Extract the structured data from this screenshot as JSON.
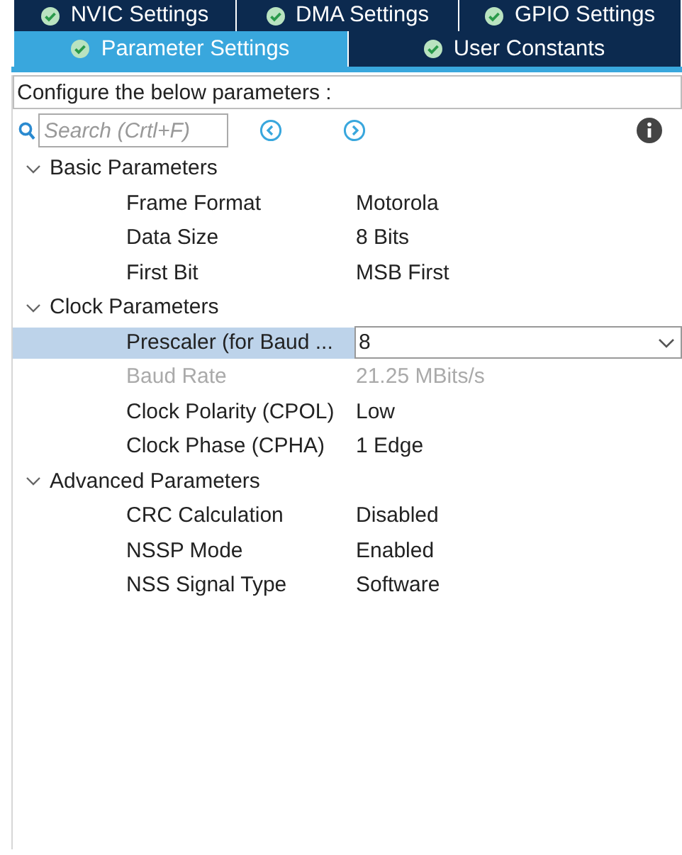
{
  "tabs_top": [
    {
      "label": "NVIC Settings",
      "selected": false
    },
    {
      "label": "DMA Settings",
      "selected": false
    },
    {
      "label": "GPIO Settings",
      "selected": false
    }
  ],
  "tabs_bottom": [
    {
      "label": "Parameter Settings",
      "selected": true
    },
    {
      "label": "User Constants",
      "selected": false
    }
  ],
  "instruction": "Configure the below parameters :",
  "search": {
    "placeholder": "Search (Crtl+F)"
  },
  "groups": [
    {
      "label": "Basic Parameters",
      "expanded": true,
      "children": [
        {
          "label": "Frame Format",
          "value": "Motorola",
          "kind": "text",
          "disabled": false,
          "selected": false
        },
        {
          "label": "Data Size",
          "value": "8 Bits",
          "kind": "text",
          "disabled": false,
          "selected": false
        },
        {
          "label": "First Bit",
          "value": "MSB First",
          "kind": "text",
          "disabled": false,
          "selected": false
        }
      ]
    },
    {
      "label": "Clock Parameters",
      "expanded": true,
      "children": [
        {
          "label": "Prescaler (for Baud ...",
          "value": "8",
          "kind": "dropdown",
          "disabled": false,
          "selected": true
        },
        {
          "label": "Baud Rate",
          "value": "21.25 MBits/s",
          "kind": "text",
          "disabled": true,
          "selected": false
        },
        {
          "label": "Clock Polarity (CPOL)",
          "value": "Low",
          "kind": "text",
          "disabled": false,
          "selected": false
        },
        {
          "label": "Clock Phase (CPHA)",
          "value": "1 Edge",
          "kind": "text",
          "disabled": false,
          "selected": false
        }
      ]
    },
    {
      "label": "Advanced Parameters",
      "expanded": true,
      "children": [
        {
          "label": "CRC Calculation",
          "value": "Disabled",
          "kind": "text",
          "disabled": false,
          "selected": false
        },
        {
          "label": "NSSP Mode",
          "value": "Enabled",
          "kind": "text",
          "disabled": false,
          "selected": false
        },
        {
          "label": "NSS Signal Type",
          "value": "Software",
          "kind": "text",
          "disabled": false,
          "selected": false
        }
      ]
    }
  ]
}
